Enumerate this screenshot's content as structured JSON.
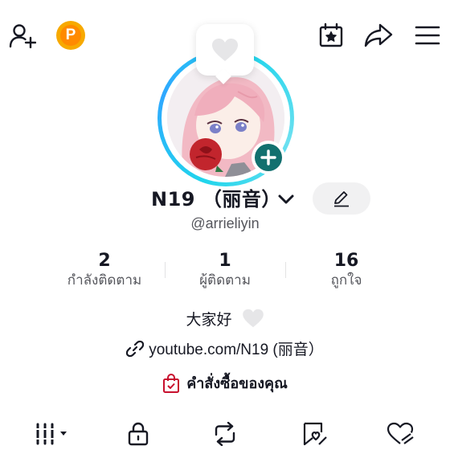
{
  "profile": {
    "name": "N19 （丽音）",
    "handle": "@arrieliyin",
    "bio": "大家好",
    "link": "youtube.com/N19 (丽音）",
    "orders_label": "คำสั่งซื้อของคุณ",
    "coin_letter": "P"
  },
  "stats": [
    {
      "value": "2",
      "label": "กำลังติดตาม"
    },
    {
      "value": "1",
      "label": "ผู้ติดตาม"
    },
    {
      "value": "16",
      "label": "ถูกใจ"
    }
  ],
  "colors": {
    "accent_ring": "#20d5ec",
    "add_button": "#12706f",
    "coin": "#f7a900",
    "orders_icon": "#c8102e",
    "text": "#161823",
    "muted": "#55565c"
  },
  "icons": {
    "top_left": [
      "add-user-icon",
      "coin-icon"
    ],
    "top_right": [
      "calendar-star-icon",
      "share-icon",
      "menu-icon"
    ],
    "tabs": [
      "grid-icon",
      "lock-icon",
      "repost-icon",
      "tagged-icon",
      "liked-icon"
    ]
  }
}
